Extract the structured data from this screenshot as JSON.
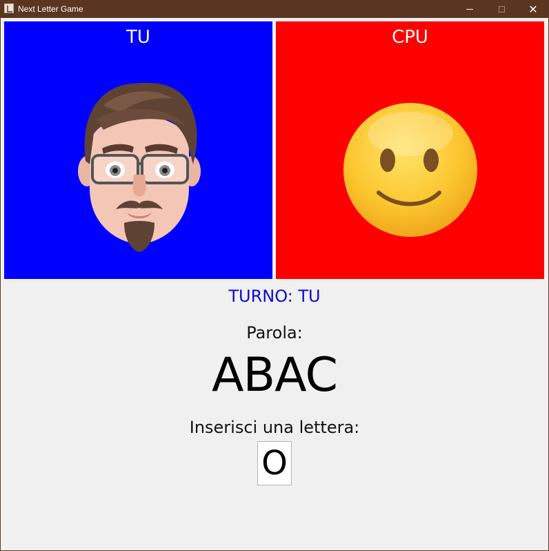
{
  "window": {
    "title": "Next Letter Game",
    "app_icon": "java-icon",
    "controls": [
      "minimize",
      "maximize",
      "close"
    ],
    "close_glyph": "✕"
  },
  "players": {
    "human": {
      "label": "TU",
      "background": "#0000ff",
      "avatar": "memoji-avatar-bearded-man-glasses"
    },
    "cpu": {
      "label": "CPU",
      "background": "#ff0000",
      "avatar": "smiley-face-emoji"
    }
  },
  "game": {
    "turn_text": "TURNO: TU",
    "turn_color": "#0a0ad4",
    "word_label": "Parola:",
    "word": "ABAC",
    "prompt": "Inserisci una lettera:",
    "input_value": "O"
  }
}
